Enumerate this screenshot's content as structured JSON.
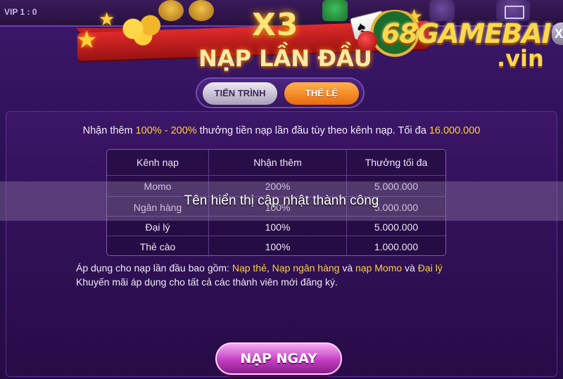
{
  "topbar": {
    "vip_text": "VIP 1 : 0"
  },
  "banner": {
    "multiplier": "X3",
    "title": "NẠP LẦN ĐẦU"
  },
  "logo": {
    "name": "68GAMEBAI",
    "suffix": ".vin"
  },
  "close_button": {
    "label": "X"
  },
  "tabs": [
    {
      "label": "TIẾN TRÌNH",
      "active": false
    },
    {
      "label": "THỂ LỆ",
      "active": true
    }
  ],
  "description": {
    "prefix": "Nhận thêm ",
    "bonus_range": "100% - 200%",
    "middle": " thưởng tiền nạp lần đầu tùy theo kênh nạp. Tối đa ",
    "max_amount": "16.000.000"
  },
  "table": {
    "headers": [
      "Kênh nạp",
      "Nhận thêm",
      "Thưởng tối đa"
    ],
    "rows": [
      [
        "Momo",
        "200%",
        "5.000.000"
      ],
      [
        "Ngân hàng",
        "100%",
        "5.000.000"
      ],
      [
        "Đại lý",
        "100%",
        "5.000.000"
      ],
      [
        "Thẻ cào",
        "100%",
        "1.000.000"
      ]
    ]
  },
  "toast": {
    "message": "Tên hiển thị cập nhật thành công"
  },
  "notes": {
    "line1_prefix": "Áp dụng cho nạp lần đầu bao gồm: ",
    "channel_card": "Nạp thẻ",
    "sep1": ", ",
    "channel_bank": "Nạp ngân hàng",
    "sep2": " và ",
    "channel_momo": "nạp Momo",
    "sep3": " và ",
    "channel_agent": "Đại lý",
    "line2": "Khuyến mãi áp dụng cho tất cả các thành viên mới đăng ký."
  },
  "cta": {
    "label": "NẠP NGAY"
  },
  "colors": {
    "highlight": "#ffd13a",
    "tab_active": "#f58a20",
    "cta": "#c23fbf"
  }
}
